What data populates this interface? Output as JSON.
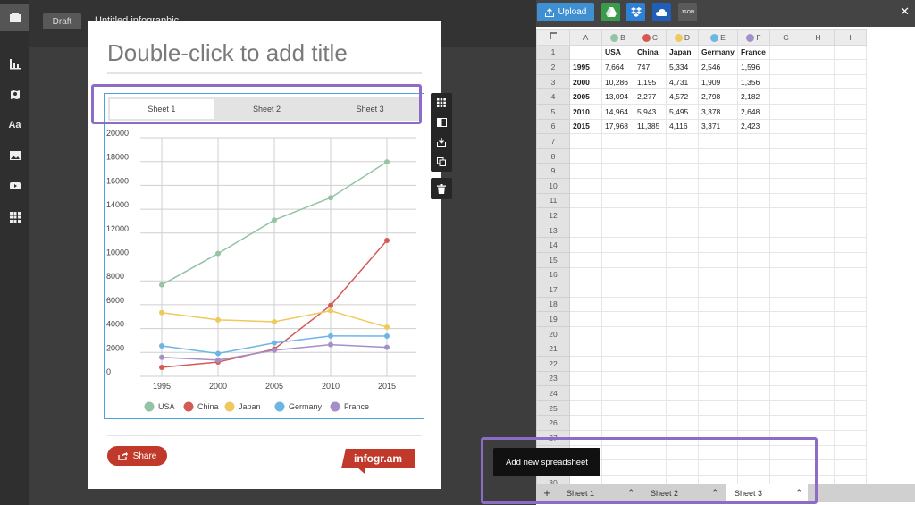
{
  "editor": {
    "draft_label": "Draft",
    "doc_title": "Untitled infographic",
    "page_title": "Double-click to add title",
    "tabs": [
      "Sheet 1",
      "Sheet 2",
      "Sheet 3"
    ],
    "share_label": "Share",
    "brand": "infogr.am"
  },
  "rail": {
    "icons": [
      "layers-icon",
      "chart-icon",
      "map-icon",
      "text-icon",
      "image-icon",
      "video-icon",
      "apps-icon"
    ],
    "text_icon_label": "Aa"
  },
  "colors": {
    "USA": "#93c4a4",
    "China": "#d45a55",
    "Japan": "#efc85e",
    "Germany": "#6cb6e3",
    "France": "#a48fc9",
    "accent": "#3f8fd3",
    "brand": "#c0392b",
    "highlight": "#8d6cc7"
  },
  "chart_data": {
    "type": "line",
    "x": [
      1995,
      2000,
      2005,
      2010,
      2015
    ],
    "ylim": [
      0,
      20000
    ],
    "yticks": [
      0,
      2000,
      4000,
      6000,
      8000,
      10000,
      12000,
      14000,
      16000,
      18000,
      20000
    ],
    "grid": true,
    "legend_position": "bottom",
    "series": [
      {
        "name": "USA",
        "values": [
          7664,
          10286,
          13094,
          14964,
          17968
        ]
      },
      {
        "name": "China",
        "values": [
          747,
          1195,
          2277,
          5943,
          11385
        ]
      },
      {
        "name": "Japan",
        "values": [
          5334,
          4731,
          4572,
          5495,
          4116
        ]
      },
      {
        "name": "Germany",
        "values": [
          2546,
          1909,
          2798,
          3378,
          3371
        ]
      },
      {
        "name": "France",
        "values": [
          1596,
          1356,
          2182,
          2648,
          2423
        ]
      }
    ]
  },
  "sheet": {
    "upload_label": "Upload",
    "json_label": "JSON",
    "columns": [
      "A",
      "B",
      "C",
      "D",
      "E",
      "F",
      "G",
      "H",
      "I"
    ],
    "column_dot_series": [
      "",
      "USA",
      "China",
      "Japan",
      "Germany",
      "France",
      "",
      "",
      ""
    ],
    "rows": [
      [
        "",
        "USA",
        "China",
        "Japan",
        "Germany",
        "France",
        "",
        "",
        ""
      ],
      [
        "1995",
        "7,664",
        "747",
        "5,334",
        "2,546",
        "1,596",
        "",
        "",
        ""
      ],
      [
        "2000",
        "10,286",
        "1,195",
        "4,731",
        "1,909",
        "1,356",
        "",
        "",
        ""
      ],
      [
        "2005",
        "13,094",
        "2,277",
        "4,572",
        "2,798",
        "2,182",
        "",
        "",
        ""
      ],
      [
        "2010",
        "14,964",
        "5,943",
        "5,495",
        "3,378",
        "2,648",
        "",
        "",
        ""
      ],
      [
        "2015",
        "17,968",
        "11,385",
        "4,116",
        "3,371",
        "2,423",
        "",
        "",
        ""
      ]
    ],
    "total_rows": 30,
    "sheet_tabs": [
      "Sheet 1",
      "Sheet 2",
      "Sheet 3"
    ],
    "active_sheet": "Sheet 3",
    "add_tooltip": "Add new spreadsheet",
    "add_symbol": "+",
    "close_symbol": "✕"
  }
}
